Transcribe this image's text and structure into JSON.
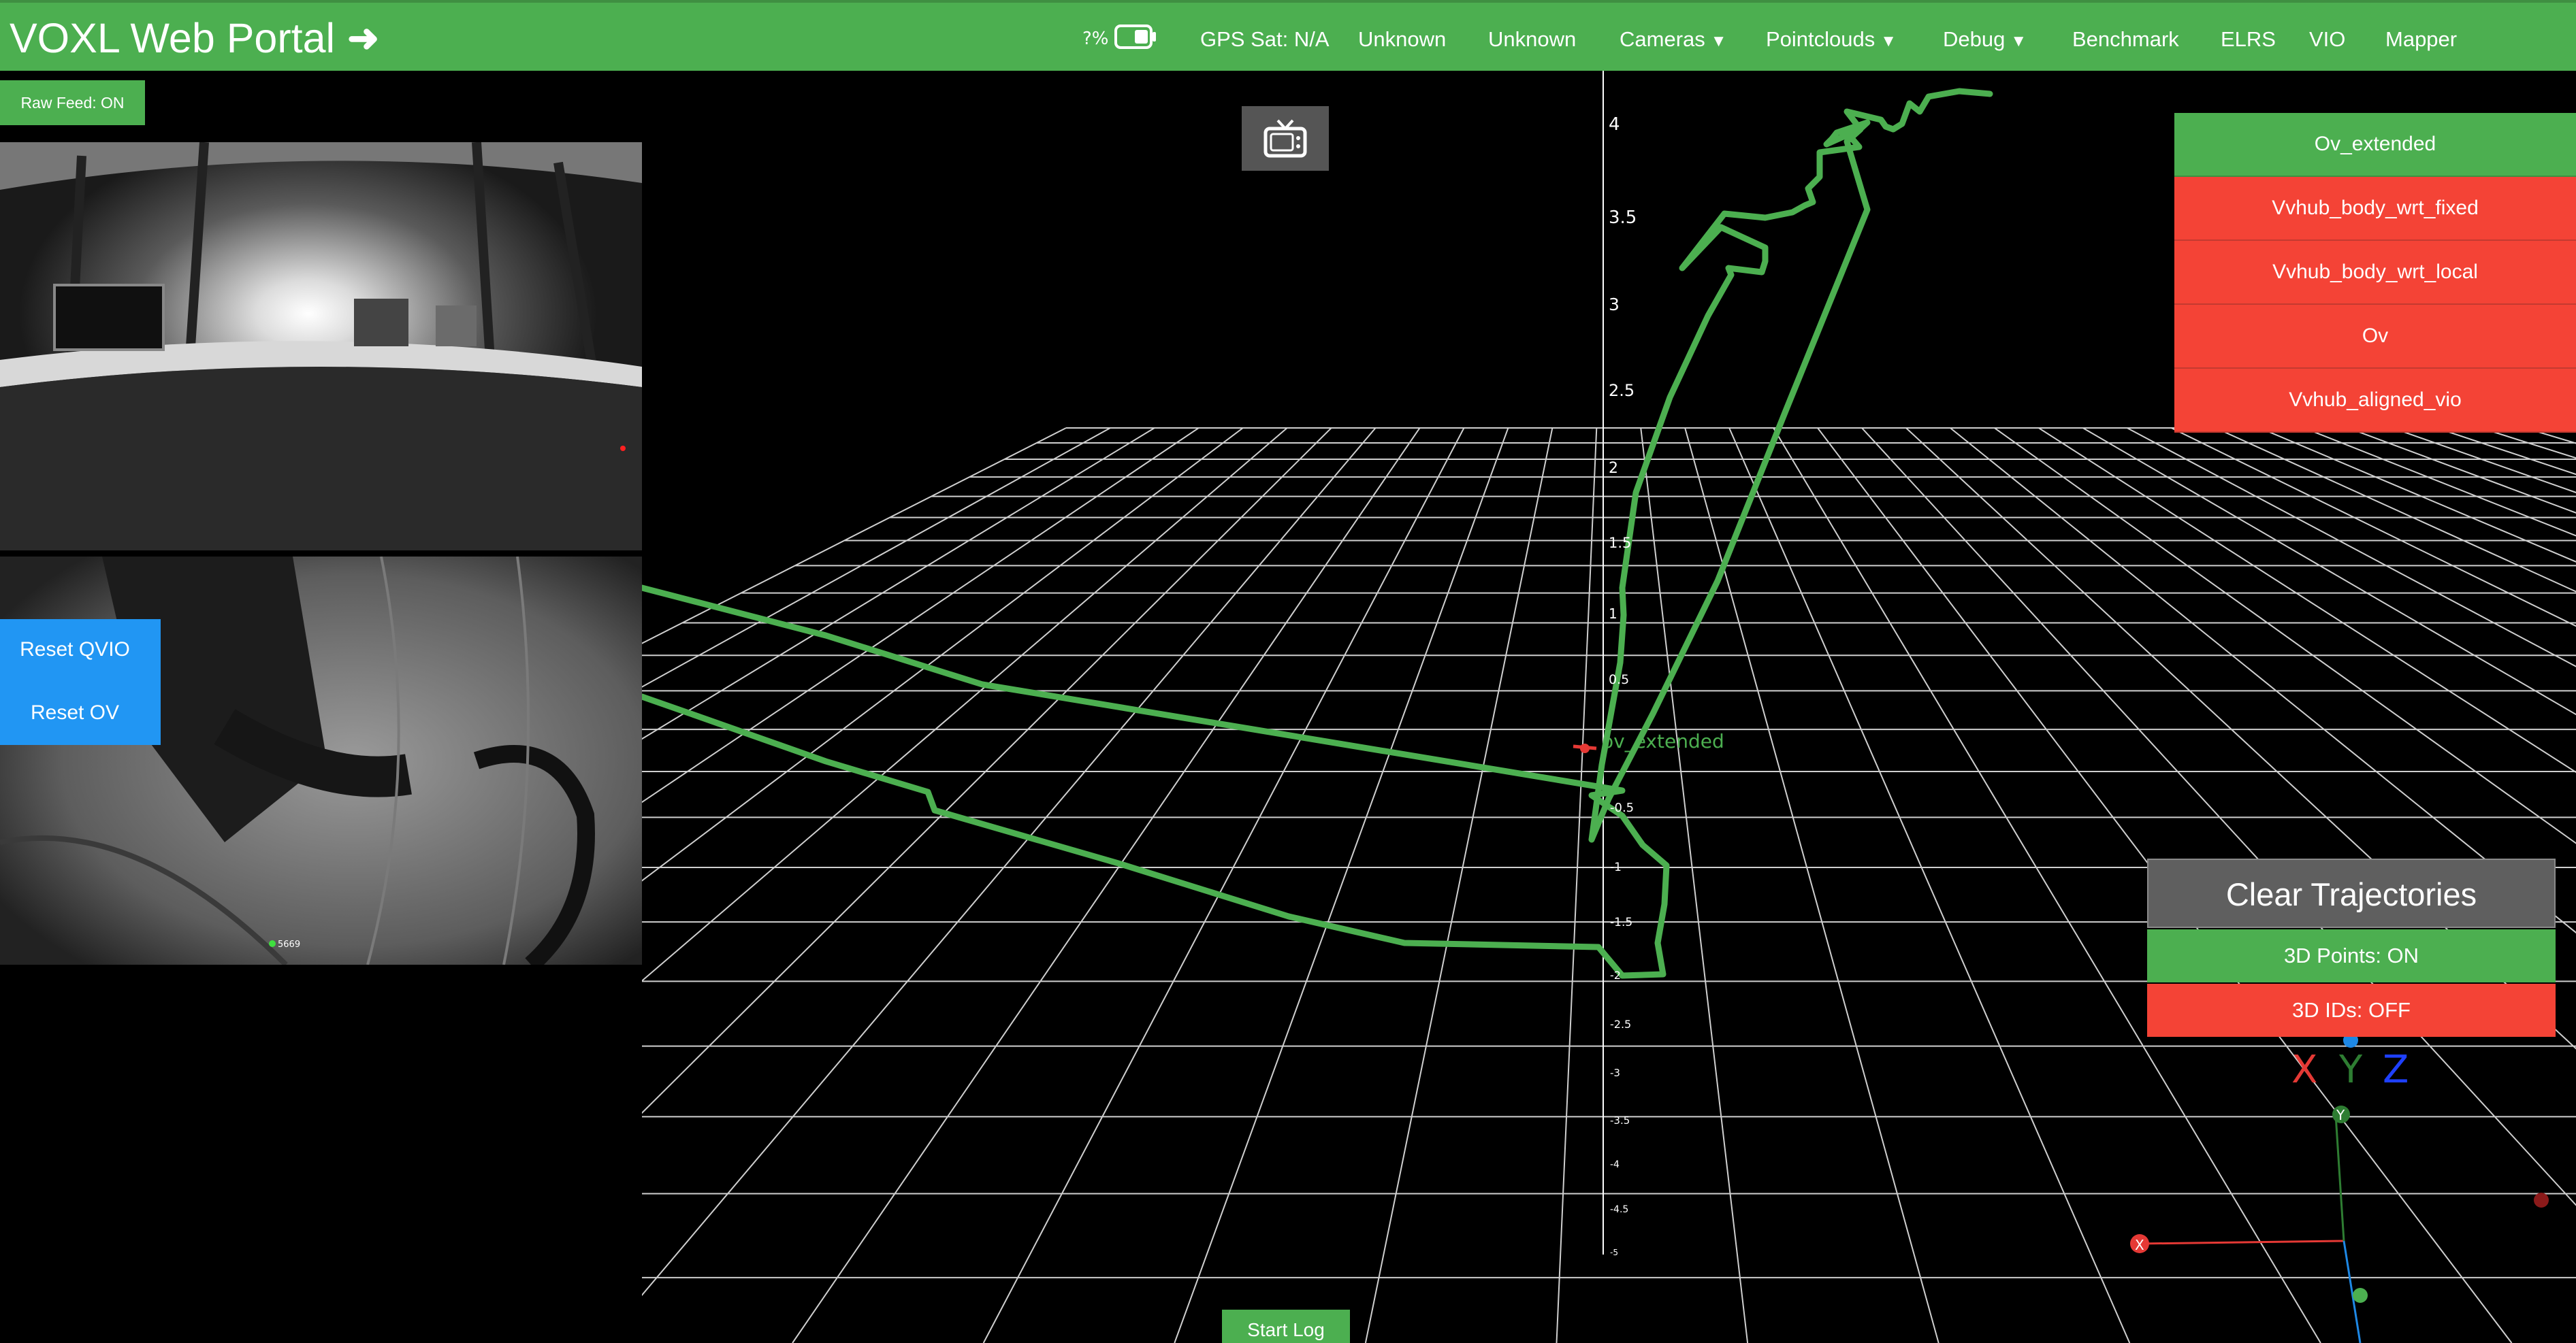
{
  "header": {
    "title": "VOXL Web Portal",
    "title_arrow": "➜",
    "battery_text": "?%",
    "battery_icon": "battery-icon",
    "gps": "GPS Sat: N/A",
    "status_1": "Unknown",
    "status_2": "Unknown",
    "nav": {
      "cameras": "Cameras",
      "pointclouds": "Pointclouds",
      "debug": "Debug",
      "benchmark": "Benchmark",
      "elrs": "ELRS",
      "vio": "VIO",
      "mapper": "Mapper"
    },
    "caret": "▼"
  },
  "left": {
    "raw_feed": "Raw Feed: ON",
    "reset_qvio": "Reset QVIO",
    "reset_ov": "Reset OV",
    "feature_id": "5669"
  },
  "scene": {
    "tv_icon": "tv-icon",
    "trajectory_label": "ov_extended",
    "z_ticks": [
      "4",
      "3.5",
      "3",
      "2.5",
      "2",
      "1.5",
      "1",
      "0.5",
      "-0.5",
      "-1",
      "-1.5",
      "-2",
      "-2.5",
      "-3",
      "-3.5",
      "-4",
      "-4.5",
      "-5"
    ],
    "axis_letters": {
      "x": "X",
      "y": "Y",
      "z": "Z"
    },
    "gizmo_labels": {
      "x": "X",
      "y": "Y"
    }
  },
  "topics": [
    {
      "label": "Ov_extended",
      "state": "on"
    },
    {
      "label": "Vvhub_body_wrt_fixed",
      "state": "off"
    },
    {
      "label": "Vvhub_body_wrt_local",
      "state": "off"
    },
    {
      "label": "Ov",
      "state": "off"
    },
    {
      "label": "Vvhub_aligned_vio",
      "state": "off"
    }
  ],
  "controls": {
    "clear_trajectories": "Clear Trajectories",
    "points_3d": "3D Points: ON",
    "ids_3d": "3D IDs: OFF",
    "start_log": "Start Log"
  },
  "colors": {
    "header_green": "#4caf50",
    "off_red": "#f44336",
    "reset_blue": "#2196f3",
    "trajectory_green": "#4caf50",
    "axis_x": "#e53935",
    "axis_y": "#2e7d32",
    "axis_z": "#1e40ff"
  }
}
